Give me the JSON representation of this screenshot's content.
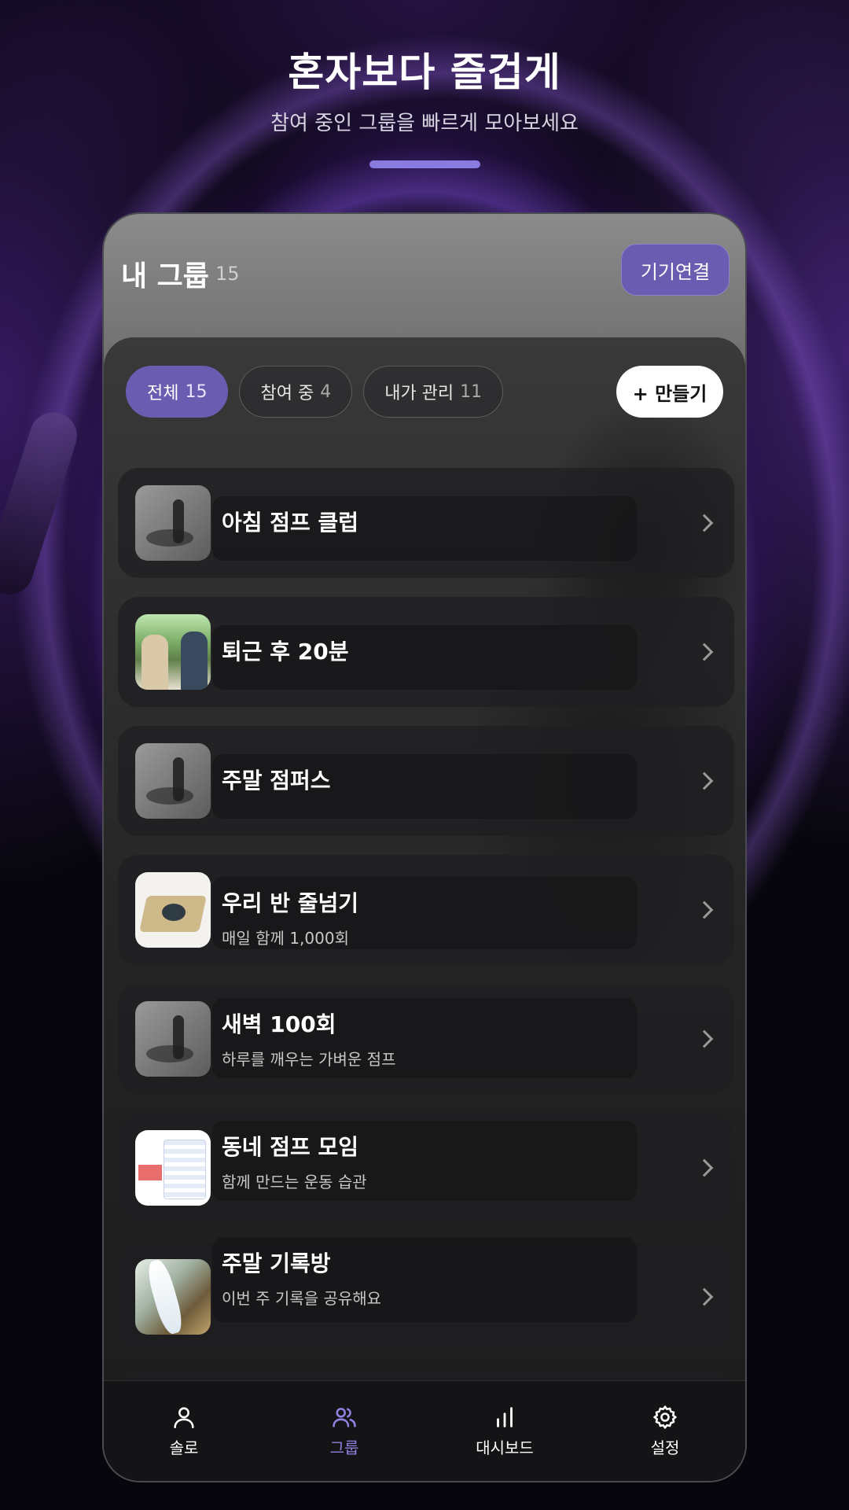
{
  "hero": {
    "title": "혼자보다 즐겁게",
    "subtitle": "참여 중인 그룹을 빠르게 모아보세요"
  },
  "header": {
    "title": "내 그룹",
    "count": "15",
    "connect_label": "기기연결"
  },
  "filters": [
    {
      "label": "전체",
      "count": "15",
      "active": true
    },
    {
      "label": "참여 중",
      "count": "4",
      "active": false
    },
    {
      "label": "내가 관리",
      "count": "11",
      "active": false
    }
  ],
  "create_label": "+ 만들기",
  "groups": [
    {
      "name": "아침 점프 클럽",
      "desc": "",
      "thumb": "t-gray"
    },
    {
      "name": "퇴근 후 20분",
      "desc": "",
      "thumb": "t-people"
    },
    {
      "name": "주말 점퍼스",
      "desc": "",
      "thumb": "t-gray"
    },
    {
      "name": "우리 반 줄넘기",
      "desc": "매일 함께 1,000회",
      "thumb": "t-device"
    },
    {
      "name": "새벽 100회",
      "desc": "하루를 깨우는 가벼운 점프",
      "thumb": "t-gray"
    },
    {
      "name": "동네 점프 모임",
      "desc": "함께 만드는 운동 습관",
      "thumb": "t-doc"
    },
    {
      "name": "주말 기록방",
      "desc": "이번 주 기록을 공유해요",
      "thumb": "t-water"
    }
  ],
  "tabs": [
    {
      "label": "솔로",
      "icon": "person-icon",
      "active": false
    },
    {
      "label": "그룹",
      "icon": "group-icon",
      "active": true
    },
    {
      "label": "대시보드",
      "icon": "bar-chart-icon",
      "active": false
    },
    {
      "label": "설정",
      "icon": "gear-icon",
      "active": false
    }
  ],
  "colors": {
    "accent": "#6a5cb0",
    "tab_active": "#8f82e0",
    "hero_bar": "#8a7be0"
  }
}
